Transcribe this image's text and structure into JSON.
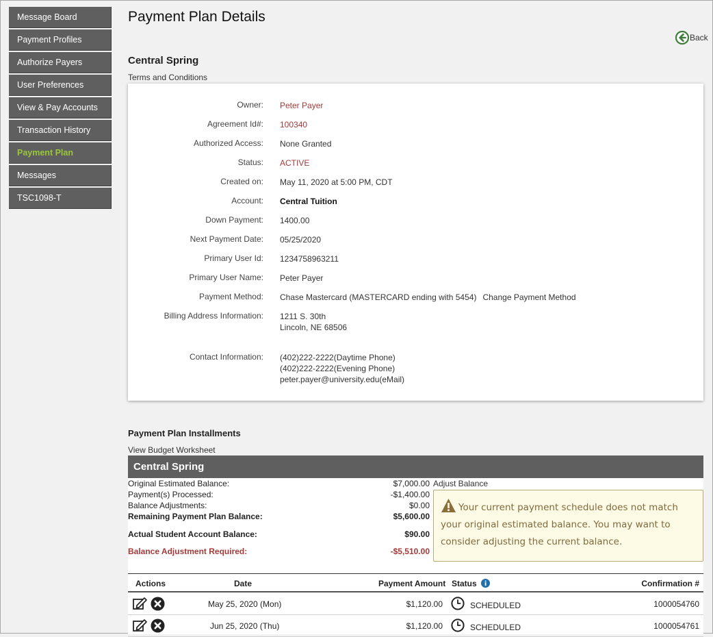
{
  "sidebar": {
    "items": [
      {
        "label": "Message Board"
      },
      {
        "label": "Payment Profiles"
      },
      {
        "label": "Authorize Payers"
      },
      {
        "label": "User Preferences"
      },
      {
        "label": "View & Pay Accounts"
      },
      {
        "label": "Transaction History"
      },
      {
        "label": "Payment Plan",
        "active": true
      },
      {
        "label": "Messages"
      },
      {
        "label": "TSC1098-T"
      }
    ]
  },
  "page": {
    "title": "Payment Plan Details",
    "back_label": "Back",
    "plan_name": "Central Spring",
    "terms_link": "Terms and Conditions"
  },
  "details": {
    "owner_label": "Owner:",
    "owner": "Peter Payer",
    "agreement_label": "Agreement Id#:",
    "agreement": "100340",
    "access_label": "Authorized Access:",
    "access": "None Granted",
    "status_label": "Status:",
    "status": "ACTIVE",
    "created_label": "Created on:",
    "created": "May 11, 2020 at 5:00 PM, CDT",
    "account_label": "Account:",
    "account": "Central Tuition",
    "down_label": "Down Payment:",
    "down": "1400.00",
    "next_label": "Next Payment Date:",
    "next": "05/25/2020",
    "user_id_label": "Primary User Id:",
    "user_id": "1234758963211",
    "user_name_label": "Primary User Name:",
    "user_name": "Peter Payer",
    "method_label": "Payment Method:",
    "method": "Chase Mastercard (MASTERCARD ending with 5454)",
    "change_method": "Change Payment Method",
    "billing_label": "Billing Address Information:",
    "billing_line1": "1211 S. 30th",
    "billing_line2": "Lincoln, NE 68506",
    "contact_label": "Contact Information:",
    "contact_day": "(402)222-2222(Daytime Phone)",
    "contact_evening": "(402)222-2222(Evening Phone)",
    "contact_email": "peter.payer@university.edu(eMail)"
  },
  "installments": {
    "heading": "Payment Plan Installments",
    "worksheet_link": "View Budget Worksheet",
    "plan_header": "Central Spring",
    "balances": [
      {
        "label": "Original Estimated Balance:",
        "value": "$7,000.00"
      },
      {
        "label": "Payment(s) Processed:",
        "value": "-$1,400.00"
      },
      {
        "label": "Balance Adjustments:",
        "value": "$0.00"
      },
      {
        "label": "Remaining Payment Plan Balance:",
        "value": "$5,600.00"
      },
      {
        "label": "Actual Student Account Balance:",
        "value": "$90.00"
      },
      {
        "label": "Balance Adjustment Required:",
        "value": "-$5,510.00"
      }
    ],
    "adjust_link": "Adjust Balance",
    "warning": "Your current payment schedule does not match your original estimated balance. You may want to consider adjusting the current balance.",
    "columns": {
      "actions": "Actions",
      "date": "Date",
      "amount": "Payment Amount",
      "status": "Status",
      "confirmation": "Confirmation #"
    },
    "rows": [
      {
        "date": "May 25, 2020 (Mon)",
        "amount": "$1,120.00",
        "status": "SCHEDULED",
        "confirmation": "1000054760"
      },
      {
        "date": "Jun 25, 2020 (Thu)",
        "amount": "$1,120.00",
        "status": "SCHEDULED",
        "confirmation": "1000054761"
      }
    ]
  },
  "colors": {
    "accent_green": "#9bc83a",
    "header_gray": "#5f5f5f",
    "alert_red": "#a33a3a",
    "warning_bg": "#fdfbe6"
  }
}
